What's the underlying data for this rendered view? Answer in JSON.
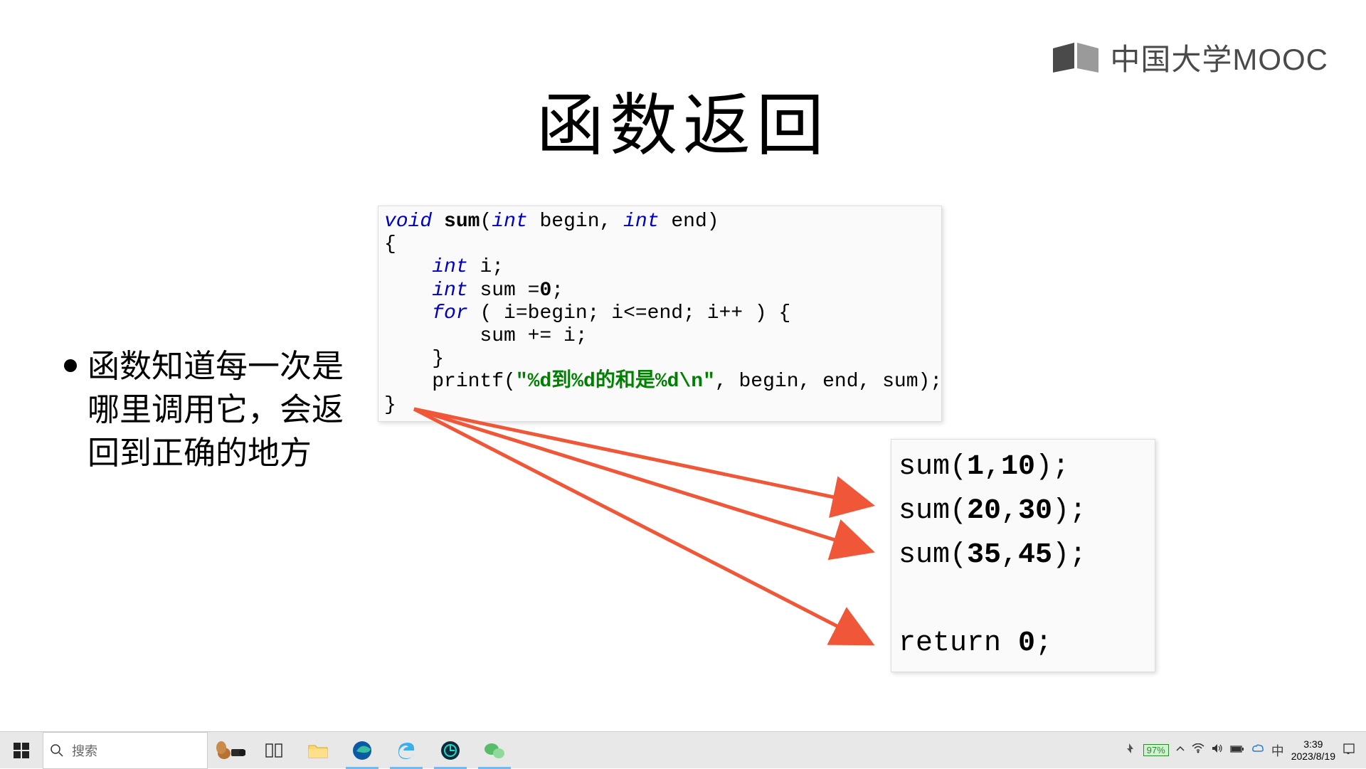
{
  "brand": {
    "text": "中国大学MOOC"
  },
  "slide": {
    "title": "函数返回",
    "bullet": "函数知道每一次是哪里调用它，会返回到正确的地方"
  },
  "code_top": {
    "l1_void": "void",
    "l1_sum": "sum",
    "l1_int1": "int",
    "l1_begin": " begin, ",
    "l1_int2": "int",
    "l1_end": " end)",
    "l2": "{",
    "l3_int": "int",
    "l3_rest": " i;",
    "l4_int": "int",
    "l4_rest": " sum =",
    "l4_zero": "0",
    "l4_semi": ";",
    "l5_for": "for",
    "l5_rest": " ( i=begin; i<=end; i++ ) {",
    "l6": "        sum += i;",
    "l7": "    }",
    "l8_a": "    printf(",
    "l8_str": "\"%d到%d的和是%d\\n\"",
    "l8_b": ", begin, end, sum);",
    "l9": "}"
  },
  "code_bottom": {
    "c1_a": "sum(",
    "c1_b": "1",
    "c1_c": ",",
    "c1_d": "10",
    "c1_e": ");",
    "c2_a": "sum(",
    "c2_b": "20",
    "c2_c": ",",
    "c2_d": "30",
    "c2_e": ");",
    "c3_a": "sum(",
    "c3_b": "35",
    "c3_c": ",",
    "c3_d": "45",
    "c3_e": ");",
    "c5_a": "return ",
    "c5_b": "0",
    "c5_c": ";"
  },
  "taskbar": {
    "search_placeholder": "搜索",
    "battery": "97%",
    "ime": "中",
    "time": "3:39",
    "date": "2023/8/19"
  }
}
